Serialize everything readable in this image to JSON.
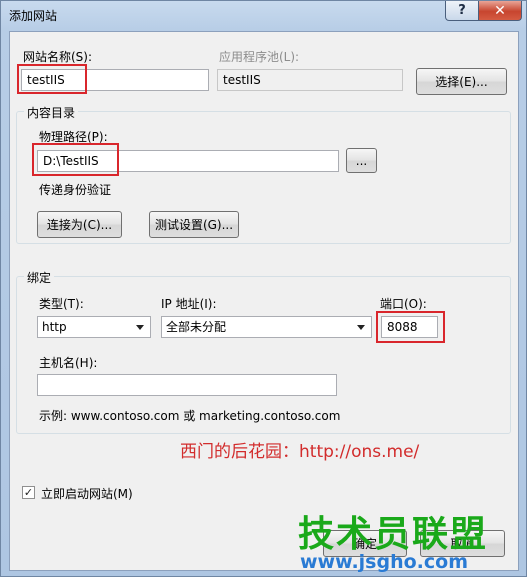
{
  "window": {
    "title": "添加网站",
    "help_glyph": "?",
    "close_glyph": "✕"
  },
  "site": {
    "name_label": "网站名称(S):",
    "name_value": "testIIS",
    "pool_label": "应用程序池(L):",
    "pool_value": "testIIS",
    "select_button": "选择(E)..."
  },
  "content_dir": {
    "group_title": "内容目录",
    "path_label": "物理路径(P):",
    "path_value": "D:\\TestIIS",
    "browse_button": "...",
    "passthrough_label": "传递身份验证",
    "connect_as_button": "连接为(C)...",
    "test_settings_button": "测试设置(G)..."
  },
  "binding": {
    "group_title": "绑定",
    "type_label": "类型(T):",
    "type_value": "http",
    "ip_label": "IP 地址(I):",
    "ip_value": "全部未分配",
    "port_label": "端口(O):",
    "port_value": "8088",
    "host_label": "主机名(H):",
    "host_value": "",
    "example_text": "示例: www.contoso.com 或 marketing.contoso.com"
  },
  "start_immediately": {
    "label": "立即启动网站(M)",
    "checked": true,
    "check_glyph": "✓"
  },
  "buttons": {
    "ok_label": "确定",
    "cancel_label": "取消"
  },
  "watermark": {
    "blog": "西门的后花园：http://ons.me/",
    "logo_cn": "技术员联盟",
    "logo_url": "www.jsgho.com"
  },
  "colors": {
    "highlight_red": "#d9262c",
    "logo_green": "#1aa91a",
    "logo_blue": "#2a7bd4"
  }
}
